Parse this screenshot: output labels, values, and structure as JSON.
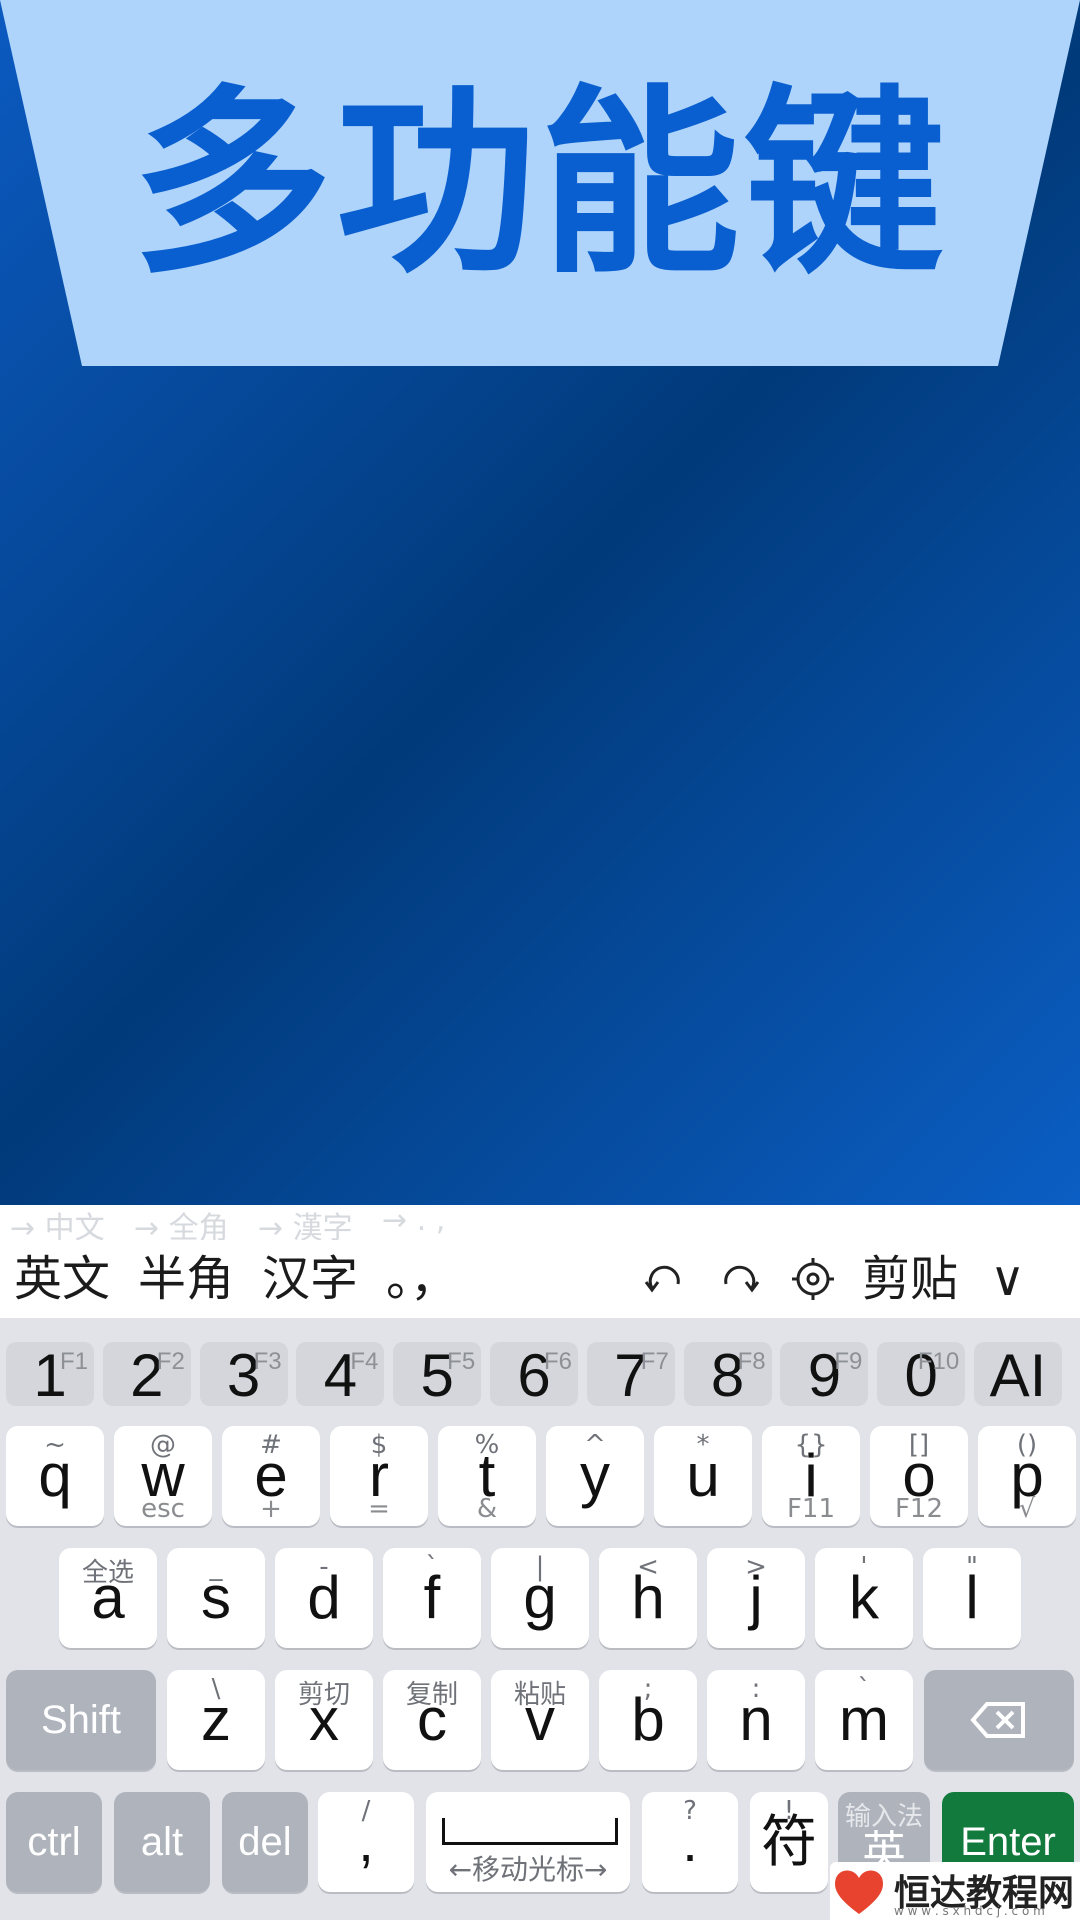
{
  "banner": {
    "title": "多功能键"
  },
  "hints": [
    "→ 中文",
    "→ 全角",
    "→ 漢字",
    "→ . ,"
  ],
  "toolbar": {
    "english": "英文",
    "halfwidth": "半角",
    "hanzi": "汉字",
    "punct": "。，",
    "clipboard": "剪贴",
    "collapse": "∨"
  },
  "number_row": [
    {
      "main": "1",
      "fn": "F1"
    },
    {
      "main": "2",
      "fn": "F2"
    },
    {
      "main": "3",
      "fn": "F3"
    },
    {
      "main": "4",
      "fn": "F4"
    },
    {
      "main": "5",
      "fn": "F5"
    },
    {
      "main": "6",
      "fn": "F6"
    },
    {
      "main": "7",
      "fn": "F7"
    },
    {
      "main": "8",
      "fn": "F8"
    },
    {
      "main": "9",
      "fn": "F9"
    },
    {
      "main": "0",
      "fn": "F10"
    },
    {
      "main": "AI",
      "fn": ""
    }
  ],
  "row1": [
    {
      "main": "q",
      "top": "~",
      "bottom": ""
    },
    {
      "main": "w",
      "top": "@",
      "bottom": "esc"
    },
    {
      "main": "e",
      "top": "#",
      "bottom": "+"
    },
    {
      "main": "r",
      "top": "$",
      "bottom": "="
    },
    {
      "main": "t",
      "top": "%",
      "bottom": "&"
    },
    {
      "main": "y",
      "top": "^",
      "bottom": ""
    },
    {
      "main": "u",
      "top": "*",
      "bottom": ""
    },
    {
      "main": "i",
      "top": "{}",
      "bottom": "F11"
    },
    {
      "main": "o",
      "top": "[]",
      "bottom": "F12"
    },
    {
      "main": "p",
      "top": "()",
      "bottom": "√"
    }
  ],
  "row2": [
    {
      "main": "a",
      "top": "全选"
    },
    {
      "main": "s",
      "top": "_"
    },
    {
      "main": "d",
      "top": "-"
    },
    {
      "main": "f",
      "top": "`"
    },
    {
      "main": "g",
      "top": "|"
    },
    {
      "main": "h",
      "top": "<"
    },
    {
      "main": "j",
      "top": ">"
    },
    {
      "main": "k",
      "top": "'"
    },
    {
      "main": "l",
      "top": "\""
    }
  ],
  "row3": [
    {
      "main": "z",
      "top": "\\"
    },
    {
      "main": "x",
      "top": "剪切"
    },
    {
      "main": "c",
      "top": "复制"
    },
    {
      "main": "v",
      "top": "粘贴"
    },
    {
      "main": "b",
      "top": ";"
    },
    {
      "main": "n",
      "top": ":"
    },
    {
      "main": "m",
      "top": "`"
    }
  ],
  "keys": {
    "shift": "Shift",
    "ctrl": "ctrl",
    "alt": "alt",
    "del": "del",
    "comma": ",",
    "comma_top": "/",
    "space_label": "←移动光标→",
    "period": ".",
    "period_top": "?",
    "symbols": "符",
    "symbols_top": "!",
    "ime_top": "输入法",
    "ime": "英",
    "enter": "Enter"
  },
  "watermark": {
    "text": "恒达教程网",
    "url": "w w w . s x h d c j . c o m"
  },
  "colors": {
    "accent": "#0a5fd0",
    "banner": "#aed4fb",
    "enter": "#117a3c"
  }
}
